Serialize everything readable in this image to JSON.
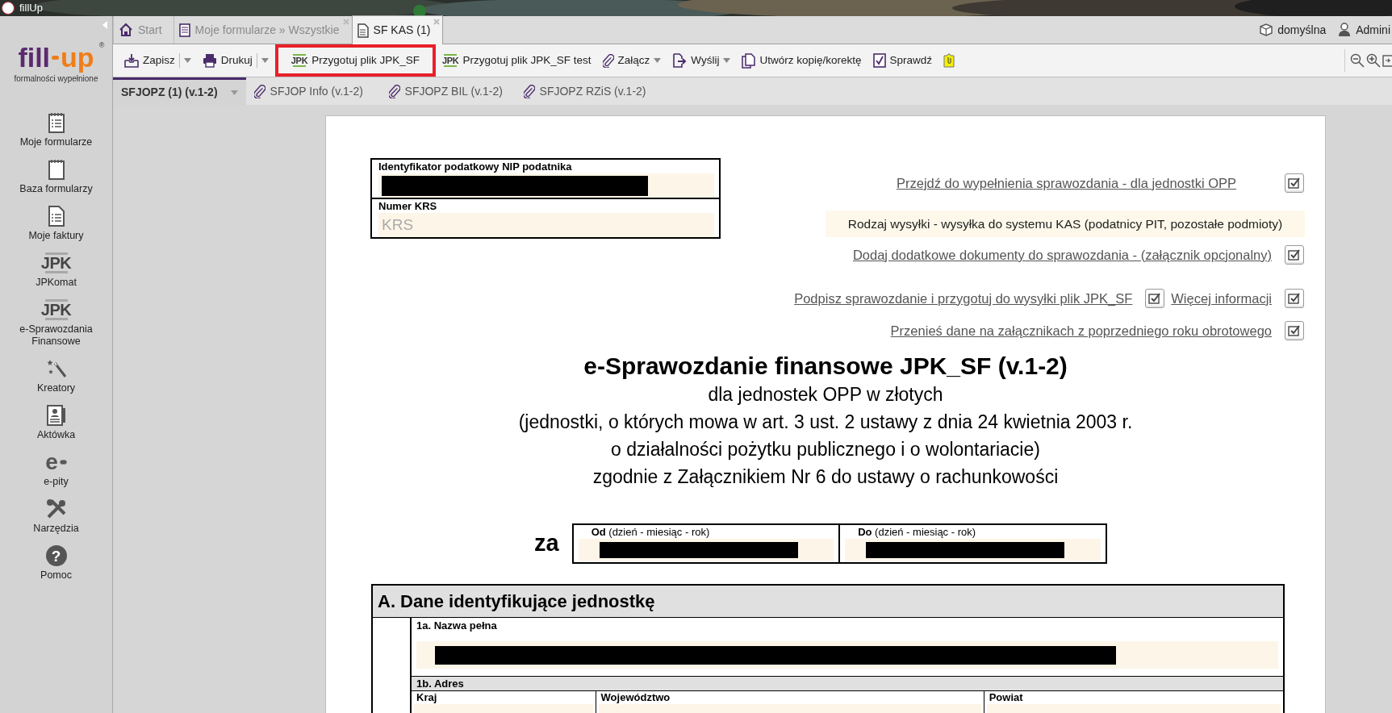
{
  "app_title": "fillUp",
  "logo": {
    "left": "fill",
    "right": "up",
    "mark": "®",
    "tagline": "formalności wypełnione"
  },
  "sidebar": [
    {
      "label": "Moje formularze",
      "kind": "notepad-list"
    },
    {
      "label": "Baza formularzy",
      "kind": "notepad"
    },
    {
      "label": "Moje faktury",
      "kind": "document"
    },
    {
      "label": "JPKomat",
      "kind": "badge",
      "badge": "JPK"
    },
    {
      "label": "e-Sprawozdania Finansowe",
      "kind": "badge",
      "badge": "JPK"
    },
    {
      "label": "Kreatory",
      "kind": "wand"
    },
    {
      "label": "Aktówka",
      "kind": "card"
    },
    {
      "label": "e-pity",
      "kind": "epit",
      "badge": "e"
    },
    {
      "label": "Narzędzia",
      "kind": "tools"
    },
    {
      "label": "Pomoc",
      "kind": "help",
      "badge": "?"
    }
  ],
  "tabs": [
    {
      "label": "Start",
      "kind": "home",
      "selected": false,
      "closable": false
    },
    {
      "label": "Moje formularze » Wszystkie",
      "kind": "form",
      "selected": false,
      "closable": true
    },
    {
      "label": "SF KAS (1)",
      "kind": "doc",
      "selected": true,
      "closable": true
    }
  ],
  "user_area": [
    {
      "label": "domyślna",
      "kind": "box"
    },
    {
      "label": "Admini",
      "kind": "user"
    }
  ],
  "toolbar": [
    {
      "label": "Zapisz",
      "kind": "save",
      "dropdown": true,
      "highlighted": false
    },
    {
      "label": "Drukuj",
      "kind": "print",
      "dropdown": true,
      "highlighted": false
    },
    {
      "label": "Przygotuj plik JPK_SF",
      "kind": "badge",
      "badge": "JPK",
      "dropdown": false,
      "highlighted": true
    },
    {
      "label": "Przygotuj plik JPK_SF test",
      "kind": "badge",
      "badge": "JPK",
      "dropdown": false,
      "highlighted": false
    },
    {
      "label": "Załącz",
      "kind": "clip",
      "dropdown": true,
      "highlighted": false
    },
    {
      "label": "Wyślij",
      "kind": "send",
      "dropdown": true,
      "highlighted": false
    },
    {
      "label": "Utwórz kopię/korektę",
      "kind": "copy",
      "dropdown": false,
      "highlighted": false
    },
    {
      "label": "Sprawdź",
      "kind": "check",
      "dropdown": false,
      "highlighted": false
    },
    {
      "kind": "tag",
      "dropdown": false,
      "highlighted": false
    }
  ],
  "view_tools": [
    {
      "kind": "zoom-out"
    },
    {
      "kind": "zoom-in"
    },
    {
      "kind": "fit"
    }
  ],
  "subtabs": [
    {
      "label": "SFJOPZ (1) (v.1-2)",
      "selected": true,
      "dropdown": true
    },
    {
      "label": "SFJOP Info (v.1-2)",
      "selected": false,
      "dropdown": false
    },
    {
      "label": "SFJOPZ BIL (v.1-2)",
      "selected": false,
      "dropdown": false
    },
    {
      "label": "SFJOPZ RZiS (v.1-2)",
      "selected": false,
      "dropdown": false
    }
  ],
  "form": {
    "id_box": [
      {
        "label": "Identyfikator podatkowy NIP podatnika",
        "redacted": true
      },
      {
        "label": "Numer KRS",
        "placeholder": "KRS",
        "redacted": false
      }
    ],
    "actions": [
      {
        "kind": "links",
        "items": [
          {
            "label": "Przejdź do wypełnienia sprawozdania - dla jednostki OPP",
            "checked": true
          }
        ]
      },
      {
        "kind": "note",
        "text": "Rodzaj wysyłki - wysyłka do systemu KAS (podatnicy PIT, pozostałe podmioty)"
      },
      {
        "kind": "links",
        "items": [
          {
            "label": "Dodaj dodatkowe dokumenty do sprawozdania - (załącznik opcjonalny)",
            "checked": true
          }
        ]
      },
      {
        "kind": "links",
        "items": [
          {
            "label": "Podpisz sprawozdanie i przygotuj do wysyłki plik JPK_SF",
            "checked": true
          },
          {
            "label": "Więcej informacji",
            "checked": true
          }
        ]
      },
      {
        "kind": "links",
        "items": [
          {
            "label": "Przenieś dane na załącznikach z poprzedniego roku obrotowego",
            "checked": true
          }
        ]
      }
    ],
    "title": "e-Sprawozdanie finansowe JPK_SF (v.1-2)",
    "subtitle_lines": [
      "dla jednostek OPP w złotych",
      "(jednostki, o których mowa w art. 3 ust. 2 ustawy z dnia 24 kwietnia 2003 r.",
      "o działalności pożytku publicznego i o wolontariacie)",
      "zgodnie z Załącznikiem Nr 6 do ustawy o rachunkowości"
    ],
    "period": {
      "prefix": "za",
      "fields": [
        {
          "label": "**Od** (dzień - miesiąc - rok)",
          "redacted": true
        },
        {
          "label": "**Do** (dzień - miesiąc - rok)",
          "redacted": true
        }
      ]
    },
    "section_a": {
      "heading": "A. Dane identyfikujące jednostkę",
      "name_field": {
        "label": "1a. Nazwa pełna",
        "redacted": true
      },
      "address_label": "1b. Adres",
      "address_columns": [
        "Kraj",
        "Województwo",
        "Powiat"
      ]
    }
  }
}
